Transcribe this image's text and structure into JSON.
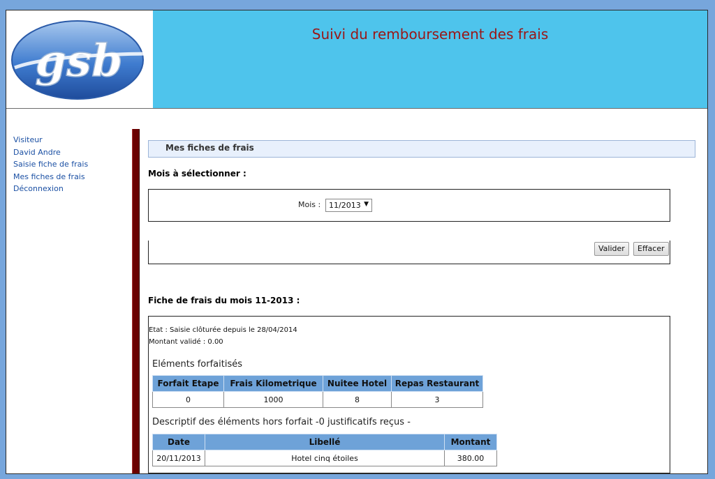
{
  "header": {
    "logo_text": "gsb",
    "title": "Suivi du remboursement des frais"
  },
  "menu": {
    "role": "Visiteur",
    "user": "David Andre",
    "items": [
      "Saisie fiche de frais",
      "Mes fiches de frais",
      "Déconnexion"
    ]
  },
  "main": {
    "section_title": "Mes fiches de frais",
    "select_heading": "Mois à sélectionner :",
    "mois_label": "Mois :",
    "mois_value": "11/2013",
    "validate_label": "Valider",
    "reset_label": "Effacer",
    "fiche_heading": "Fiche de frais du mois 11-2013 :",
    "etat": "Etat : Saisie clôturée depuis le 28/04/2014",
    "montant_valide": "Montant validé : 0.00",
    "forfait_caption": "Eléments forfaitisés",
    "forfait_headers": [
      "Forfait Etape",
      "Frais Kilometrique",
      "Nuitee Hotel",
      "Repas Restaurant"
    ],
    "forfait_values": [
      "0",
      "1000",
      "8",
      "3"
    ],
    "hors_forfait_caption": "Descriptif des éléments hors forfait -0 justificatifs reçus -",
    "hors_forfait_headers": [
      "Date",
      "Libellé",
      "Montant"
    ],
    "hors_forfait_rows": [
      [
        "20/11/2013",
        "Hotel cinq étoiles",
        "380.00"
      ]
    ]
  },
  "colors": {
    "background": "#77a6dc",
    "header": "#4ec4ec",
    "title": "#9a1616",
    "link": "#1a4fa3",
    "table_header": "#6ea2d8",
    "side_bar": "#6b0000"
  }
}
